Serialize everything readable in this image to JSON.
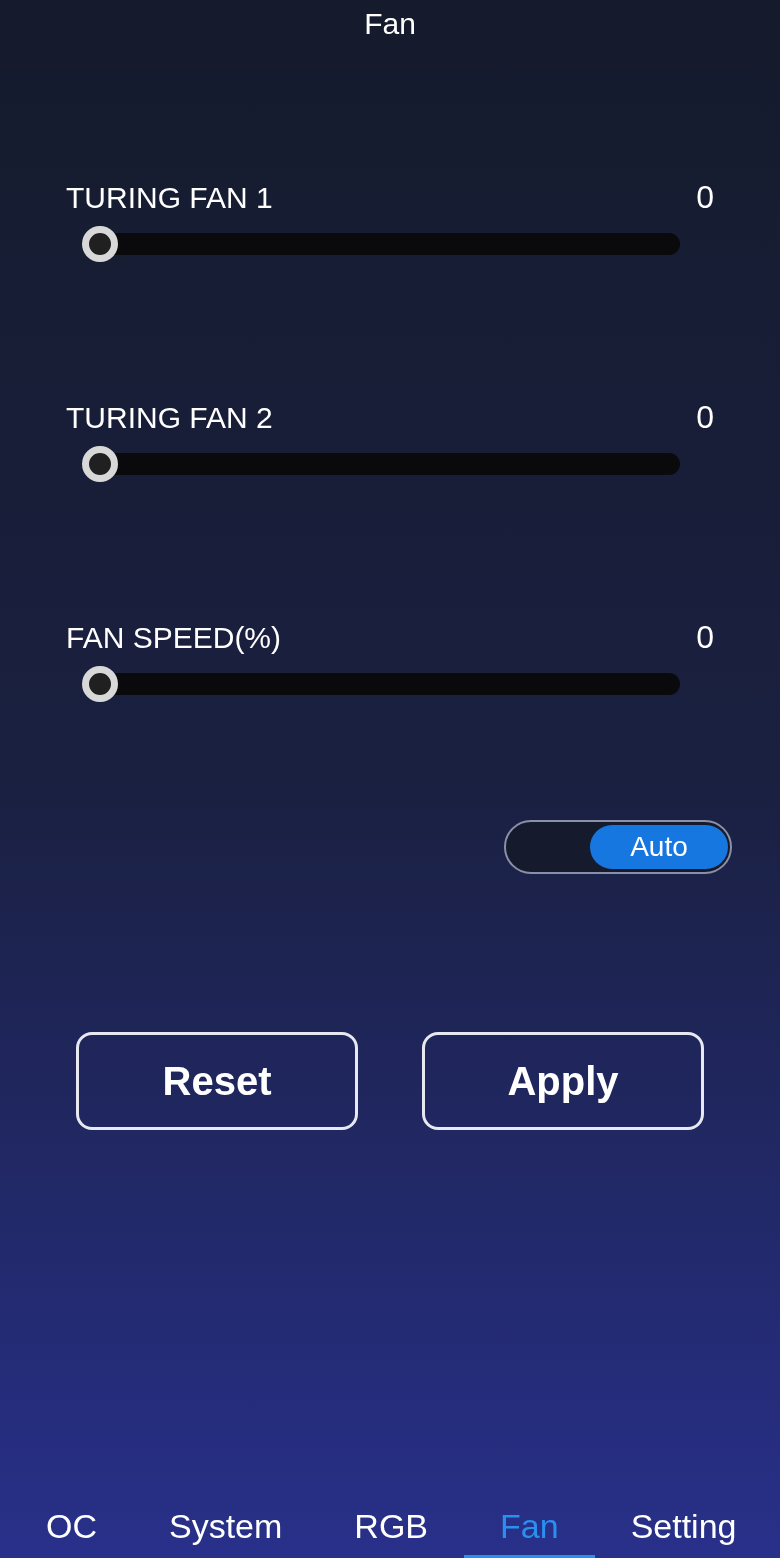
{
  "header": {
    "title": "Fan"
  },
  "sliders": [
    {
      "label": "TURING FAN 1",
      "reading": "0",
      "level": 0
    },
    {
      "label": "TURING FAN 2",
      "reading": "0",
      "level": 0
    },
    {
      "label": "FAN SPEED(%)",
      "reading": "0",
      "level": 0
    }
  ],
  "mode_toggle": {
    "label": "Auto",
    "on": true
  },
  "buttons": [
    "Reset",
    "Apply"
  ],
  "nav": [
    {
      "label": "OC",
      "selected": false
    },
    {
      "label": "System",
      "selected": false
    },
    {
      "label": "RGB",
      "selected": false
    },
    {
      "label": "Fan",
      "selected": true
    },
    {
      "label": "Setting",
      "selected": false
    }
  ]
}
